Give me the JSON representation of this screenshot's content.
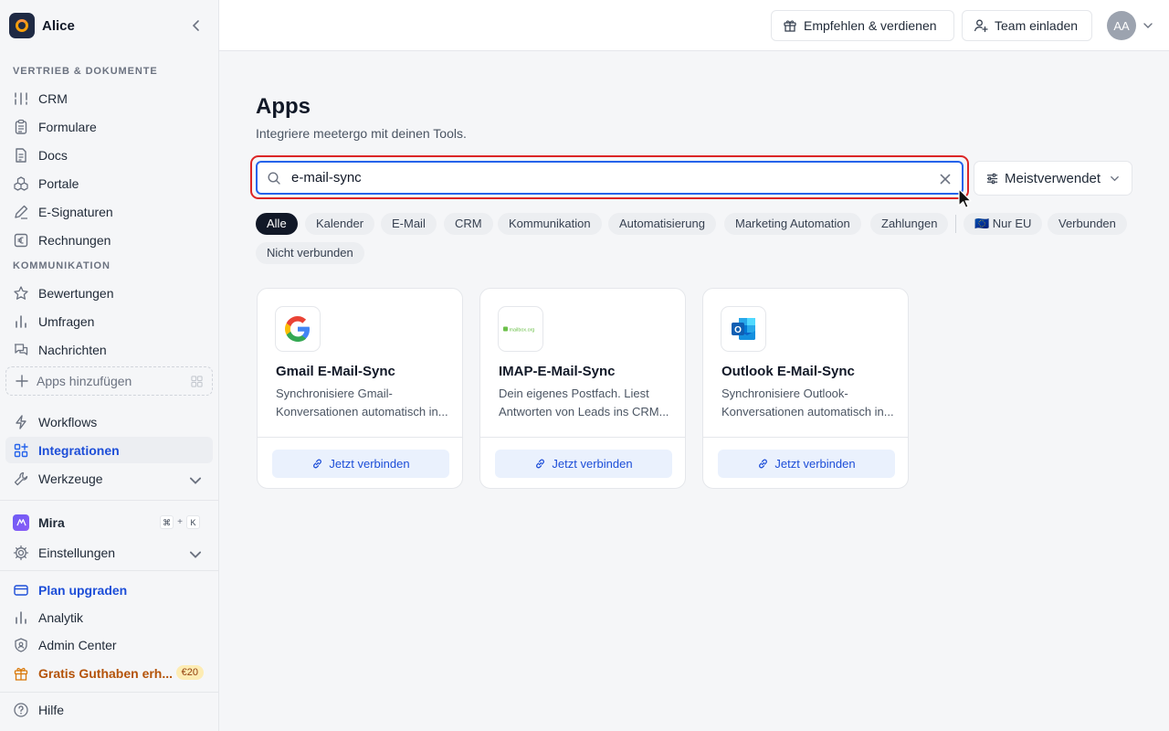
{
  "sidebar": {
    "workspace": "Alice",
    "section_sales": "VERTRIEB & DOKUMENTE",
    "section_comm": "KOMMUNIKATION",
    "items": [
      {
        "label": "CRM",
        "icon": "crm-icon"
      },
      {
        "label": "Formulare",
        "icon": "clipboard-icon"
      },
      {
        "label": "Docs",
        "icon": "document-icon"
      },
      {
        "label": "Portale",
        "icon": "portal-icon"
      },
      {
        "label": "E-Signaturen",
        "icon": "pen-icon"
      },
      {
        "label": "Rechnungen",
        "icon": "euro-icon"
      },
      {
        "label": "Bewertungen",
        "icon": "star-icon"
      },
      {
        "label": "Umfragen",
        "icon": "bar-chart-icon"
      },
      {
        "label": "Nachrichten",
        "icon": "chat-icon"
      }
    ],
    "add_apps": "Apps hinzufügen",
    "workflows": "Workflows",
    "integrations": "Integrationen",
    "tools": "Werkzeuge",
    "mira": "Mira",
    "shortcut_cmd": "⌘",
    "shortcut_plus": "+",
    "shortcut_key": "K",
    "settings": "Einstellungen",
    "upgrade": "Plan upgraden",
    "analytics": "Analytik",
    "admin": "Admin Center",
    "credit": "Gratis Guthaben erh...",
    "credit_badge": "€20",
    "help": "Hilfe"
  },
  "topbar": {
    "refer": "Empfehlen & verdienen",
    "invite": "Team einladen",
    "avatar": "AA"
  },
  "main": {
    "title": "Apps",
    "subtitle": "Integriere meetergo mit deinen Tools.",
    "search_value": "e-mail-sync",
    "sort_label": "Meistverwendet",
    "filters": [
      "Alle",
      "Kalender",
      "E-Mail",
      "CRM",
      "Kommunikation",
      "Automatisierung",
      "Marketing Automation",
      "Zahlungen",
      "🇪🇺 Nur EU",
      "Verbunden",
      "Nicht verbunden"
    ],
    "active_filter": "Alle",
    "cards": [
      {
        "title": "Gmail E-Mail-Sync",
        "desc1": "Synchronisiere Gmail-",
        "desc2": "Konversationen automatisch in...",
        "button": "Jetzt verbinden"
      },
      {
        "title": "IMAP-E-Mail-Sync",
        "desc1": "Dein eigenes Postfach. Liest",
        "desc2": "Antworten von Leads ins CRM...",
        "button": "Jetzt verbinden",
        "logo_text": "mailbox.org"
      },
      {
        "title": "Outlook E-Mail-Sync",
        "desc1": "Synchronisiere Outlook-",
        "desc2": "Konversationen automatisch in...",
        "button": "Jetzt verbinden"
      }
    ]
  },
  "colors": {
    "accent": "#2563eb",
    "highlight": "#dc2626",
    "upgrade": "#1d4ed8",
    "credit": "#b45309"
  }
}
